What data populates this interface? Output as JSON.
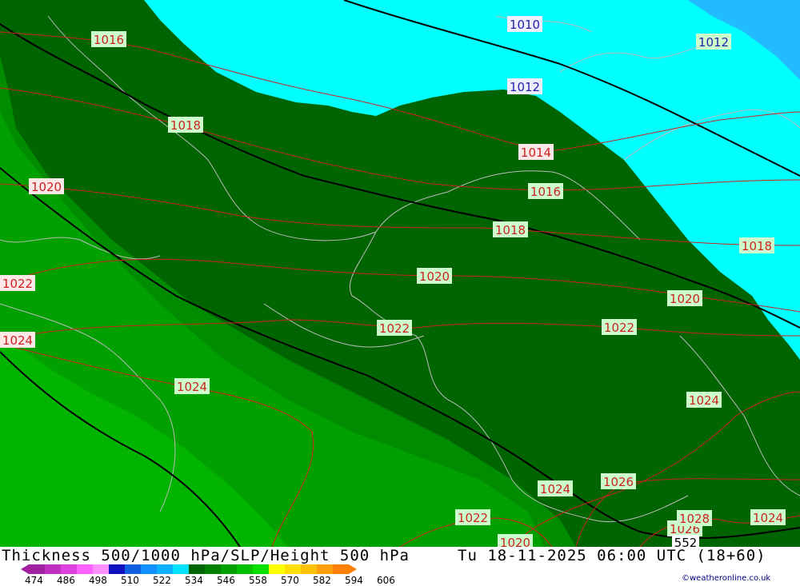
{
  "map": {
    "isobar_labels": [
      "1010",
      "1012",
      "1012",
      "1014",
      "1016",
      "1016",
      "1018",
      "1018",
      "1018",
      "1020",
      "1020",
      "1020",
      "1022",
      "1022",
      "1022",
      "1024",
      "1024",
      "1024",
      "1024",
      "1024",
      "1026",
      "1026",
      "1028",
      "1022",
      "1020"
    ],
    "thickness_contour_label": "552",
    "colors": {
      "band_534": "#006400",
      "band_540": "#008c00",
      "band_546": "#00a000",
      "band_552": "#00b400",
      "band_528": "#00ffff",
      "band_522": "#00c0ff",
      "isobar": "#cc2222",
      "border": "#bbbbbb"
    }
  },
  "footer": {
    "title": "Thickness 500/1000 hPa/SLP/Height 500 hPa",
    "valid_time": "Tu 18-11-2025 06:00 UTC (18+60)",
    "credit": "©weatheronline.co.uk",
    "legend": {
      "ticks": [
        "474",
        "486",
        "498",
        "510",
        "522",
        "534",
        "546",
        "558",
        "570",
        "582",
        "594",
        "606"
      ],
      "colors": [
        "#a020a0",
        "#c030c0",
        "#e040e0",
        "#ff60ff",
        "#ff90ff",
        "#1010c0",
        "#1060e0",
        "#1090ff",
        "#10b0ff",
        "#00e0ff",
        "#006400",
        "#008000",
        "#00a000",
        "#00c000",
        "#00e000",
        "#ffff00",
        "#ffe000",
        "#ffc000",
        "#ffa000",
        "#ff8000"
      ]
    }
  }
}
